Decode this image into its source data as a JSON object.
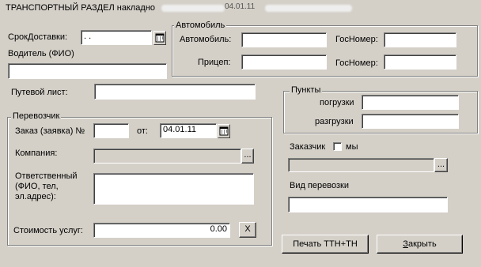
{
  "title": {
    "main": "ТРАНСПОРТНЫЙ РАЗДЕЛ",
    "suffix": "накладно",
    "date_fragment": "04.01.11"
  },
  "delivery": {
    "date_label": "СрокДоставки:",
    "date_value": " .  . ",
    "driver_label": "Водитель (ФИО)",
    "driver_value": ""
  },
  "vehicle": {
    "group_label": "Автомобиль",
    "car_label": "Автомобиль:",
    "car_value": "",
    "car_plate_label": "ГосНомер:",
    "car_plate_value": "",
    "trailer_label": "Прицеп:",
    "trailer_value": "",
    "trailer_plate_label": "ГосНомер:",
    "trailer_plate_value": ""
  },
  "waybill": {
    "label": "Путевой лист:",
    "value": ""
  },
  "points": {
    "group_label": "Пункты",
    "loading_label": "погрузки",
    "loading_value": "",
    "unloading_label": "разгрузки",
    "unloading_value": ""
  },
  "carrier": {
    "group_label": "Перевозчик",
    "order_label": "Заказ (заявка)  №",
    "order_number": "",
    "order_from_label": "от:",
    "order_date": "04.01.11",
    "company_label": "Компания:",
    "company_value": "",
    "company_button": "...",
    "responsible_label_1": "Ответственный",
    "responsible_label_2": "(ФИО, тел,",
    "responsible_label_3": "эл.адрес):",
    "responsible_value": "",
    "cost_label": "Стоимость услуг:",
    "cost_value": "0.00",
    "clear_button": "X"
  },
  "customer": {
    "label": "Заказчик",
    "we_label": "мы",
    "we_checked": false,
    "value": "",
    "button": "...",
    "transport_type_label": "Вид перевозки",
    "transport_type_value": ""
  },
  "buttons": {
    "print": "Печать ТТН+ТН",
    "close": "Закрыть"
  },
  "colors": {
    "face": "#d4d0c8",
    "field": "#ffffff",
    "shadow": "#808080"
  }
}
